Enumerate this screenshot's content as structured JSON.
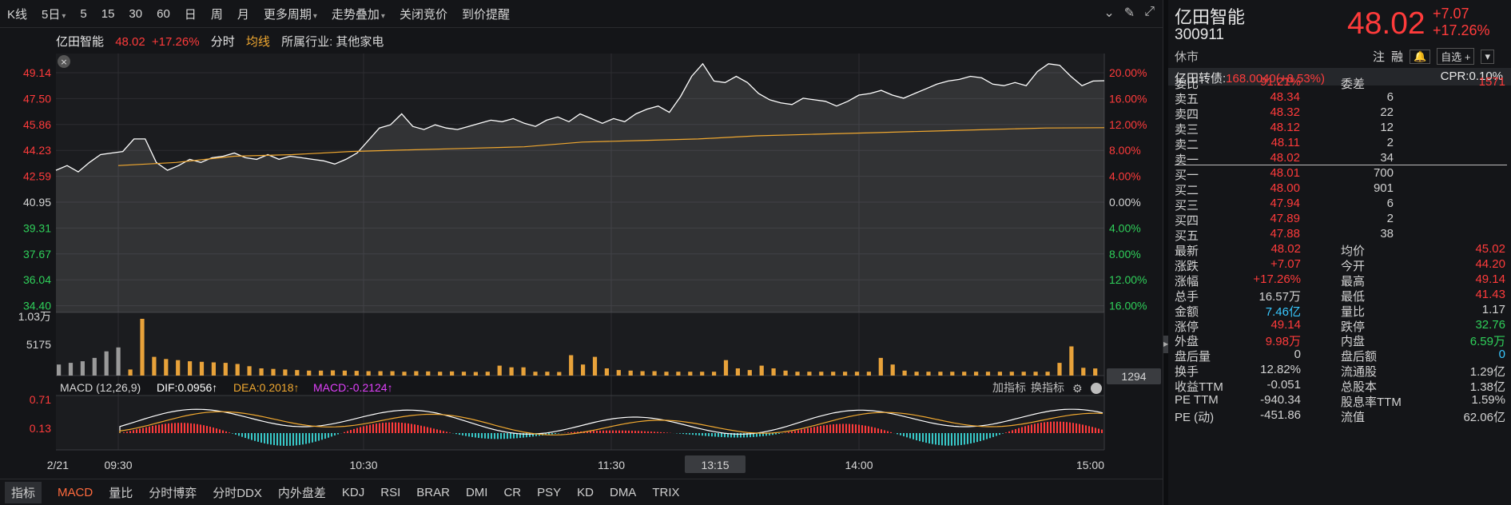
{
  "toolbar": {
    "items": [
      "K线",
      "5日",
      "5",
      "15",
      "30",
      "60",
      "日",
      "周",
      "月",
      "更多周期",
      "走势叠加",
      "关闭竞价",
      "到价提醒"
    ]
  },
  "chart_info": {
    "name": "亿田智能",
    "price": "48.02",
    "pct": "+17.26%",
    "tab": "分时",
    "avg": "均线",
    "industry": "所属行业: 其他家电"
  },
  "price_axis_left": [
    "49.14",
    "47.50",
    "45.86",
    "44.23",
    "42.59",
    "40.95",
    "39.31",
    "37.67",
    "36.04",
    "34.40"
  ],
  "pct_axis_right": [
    "20.00%",
    "16.00%",
    "12.00%",
    "8.00%",
    "4.00%",
    "0.00%",
    "4.00%",
    "8.00%",
    "12.00%",
    "16.00%"
  ],
  "volume_axis": [
    "1.03万",
    "5175"
  ],
  "volume_last": "1294",
  "macd_label": {
    "title": "MACD (12,26,9)",
    "dif": "DIF:0.0956",
    "dea": "DEA:0.2018",
    "macd": "MACD:-0.2124",
    "add": "加指标",
    "switch": "换指标"
  },
  "macd_axis": [
    "0.71",
    "0.13"
  ],
  "time_axis": [
    "2/21",
    "09:30",
    "10:30",
    "11:30",
    "13:15",
    "14:00",
    "15:00"
  ],
  "bottom_tabs": [
    "指标",
    "MACD",
    "量比",
    "分时博弈",
    "分时DDX",
    "内外盘差",
    "KDJ",
    "RSI",
    "BRAR",
    "DMI",
    "CR",
    "PSY",
    "KD",
    "DMA",
    "TRIX"
  ],
  "colors": {
    "up": "#ff3b3b",
    "down": "#2fd05a",
    "avg": "#f0a830",
    "line": "#ffffff",
    "macd": "#e040fb"
  },
  "chart_data": {
    "type": "line",
    "title": "",
    "series": [
      {
        "name": "price",
        "values": [
          42.3,
          42.6,
          42.2,
          42.8,
          43.3,
          43.4,
          43.5,
          44.3,
          44.3,
          42.8,
          42.3,
          42.6,
          43.0,
          42.8,
          43.1,
          43.2,
          43.4,
          43.1,
          43.0,
          43.3,
          43.0,
          43.2,
          43.1,
          43.0,
          42.9,
          42.7,
          43.0,
          43.4,
          44.2,
          45.0,
          45.2,
          45.9,
          45.1,
          44.9,
          45.2,
          45.0,
          44.9,
          45.1,
          45.3,
          45.5,
          45.4,
          45.6,
          45.3,
          45.1,
          45.5,
          45.7,
          45.4,
          45.9,
          45.6,
          45.3,
          45.6,
          45.4,
          45.9,
          46.2,
          46.4,
          46.0,
          47.0,
          48.3,
          49.1,
          48.0,
          47.9,
          48.3,
          47.9,
          47.2,
          46.8,
          46.6,
          46.5,
          46.9,
          46.8,
          46.7,
          46.4,
          46.7,
          47.1,
          47.2,
          47.4,
          47.1,
          46.9,
          47.2,
          47.5,
          47.8,
          48.0,
          48.1,
          48.3,
          48.2,
          47.8,
          47.7,
          47.9,
          47.7,
          48.6,
          49.1,
          49.0,
          48.3,
          47.7,
          48.0,
          48.02
        ]
      },
      {
        "name": "avg",
        "values": [
          42.6,
          42.8,
          43.2,
          43.3,
          43.5,
          43.6,
          43.7,
          43.8,
          44.1,
          44.2,
          44.3,
          44.5,
          44.6,
          44.7,
          44.8,
          44.9,
          45.0,
          45.02
        ]
      },
      {
        "name": "volume",
        "values": [
          2000,
          2300,
          2600,
          3200,
          4400,
          5100,
          1100,
          10300,
          3400,
          3000,
          2800,
          2600,
          2500,
          2400,
          2300,
          2100,
          1700,
          1300,
          1200,
          1100,
          1000,
          900,
          900,
          950,
          900,
          850,
          800,
          800,
          800,
          700,
          800,
          750,
          700,
          750,
          700,
          650,
          700,
          1800,
          1500,
          1500,
          700,
          700,
          650,
          3700,
          2000,
          3400,
          1300,
          1000,
          900,
          800,
          800,
          700,
          700,
          700,
          700,
          700,
          2800,
          1300,
          1000,
          1800,
          1300,
          900,
          700,
          700,
          700,
          700,
          700,
          700,
          700,
          3200,
          2000,
          900,
          700,
          700,
          700,
          700,
          700,
          700,
          700,
          700,
          700,
          700,
          700,
          700,
          2300,
          5300,
          1400,
          1294
        ]
      }
    ],
    "ylim": [
      34.4,
      49.14
    ],
    "xlabel": "",
    "ylabel": ""
  },
  "quote": {
    "name": "亿田智能",
    "code": "300911",
    "status": "休市",
    "price": "48.02",
    "chg": "+7.07",
    "pct": "+17.26%",
    "btn_note": "注",
    "btn_margin": "融",
    "btn_watch": "自选 +",
    "convert_label": "亿田转债:",
    "convert_value": "168.0040(+8.53%)",
    "cpr": "CPR:0.10%",
    "weibi": [
      "委比",
      "91.21%",
      "委差",
      "1571"
    ],
    "asks": [
      [
        "卖五",
        "48.34",
        "6"
      ],
      [
        "卖四",
        "48.32",
        "22"
      ],
      [
        "卖三",
        "48.12",
        "12"
      ],
      [
        "卖二",
        "48.11",
        "2"
      ],
      [
        "卖一",
        "48.02",
        "34"
      ]
    ],
    "bids": [
      [
        "买一",
        "48.01",
        "700"
      ],
      [
        "买二",
        "48.00",
        "901"
      ],
      [
        "买三",
        "47.94",
        "6"
      ],
      [
        "买四",
        "47.89",
        "2"
      ],
      [
        "买五",
        "47.88",
        "38"
      ]
    ],
    "stats": [
      [
        "最新",
        "48.02",
        "均价",
        "45.02"
      ],
      [
        "涨跌",
        "+7.07",
        "今开",
        "44.20"
      ],
      [
        "涨幅",
        "+17.26%",
        "最高",
        "49.14"
      ],
      [
        "总手",
        "16.57万",
        "最低",
        "41.43"
      ],
      [
        "金额",
        "7.46亿",
        "量比",
        "1.17"
      ],
      [
        "涨停",
        "49.14",
        "跌停",
        "32.76"
      ],
      [
        "外盘",
        "9.98万",
        "内盘",
        "6.59万"
      ],
      [
        "盘后量",
        "0",
        "盘后额",
        "0"
      ],
      [
        "换手",
        "12.82%",
        "流通股",
        "1.29亿"
      ],
      [
        "收益TTM",
        "-0.051",
        "总股本",
        "1.38亿"
      ],
      [
        "PE TTM",
        "-940.34",
        "股息率TTM",
        "1.59%"
      ],
      [
        "PE (动)",
        "-451.86",
        "流值",
        "62.06亿"
      ]
    ]
  }
}
